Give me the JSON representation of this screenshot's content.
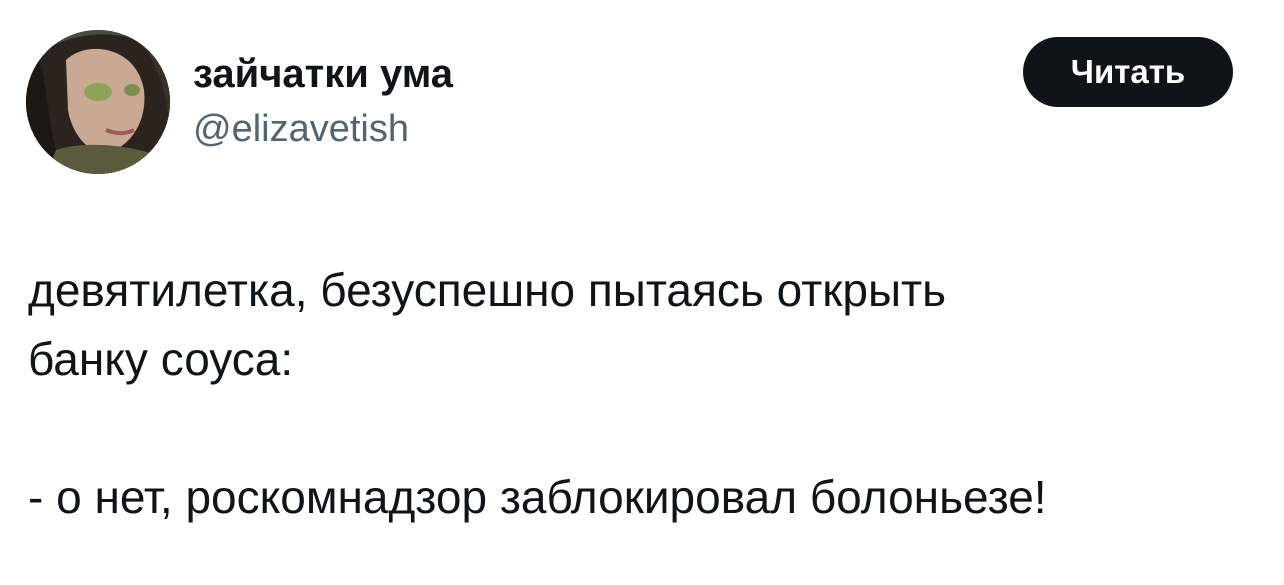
{
  "author": {
    "display_name": "зайчатки ума",
    "handle": "@elizavetish",
    "avatar_icon": "user-avatar-photo"
  },
  "follow_button": {
    "label": "Читать"
  },
  "tweet": {
    "lines": [
      "девятилетка, безуспешно пытаясь открыть",
      "банку соуса:",
      "",
      "- о нет, роскомнадзор заблокировал болоньезе!"
    ]
  },
  "colors": {
    "text_primary": "#0f1419",
    "text_secondary": "#536471",
    "button_bg": "#0f1419",
    "button_text": "#ffffff",
    "background": "#ffffff"
  }
}
